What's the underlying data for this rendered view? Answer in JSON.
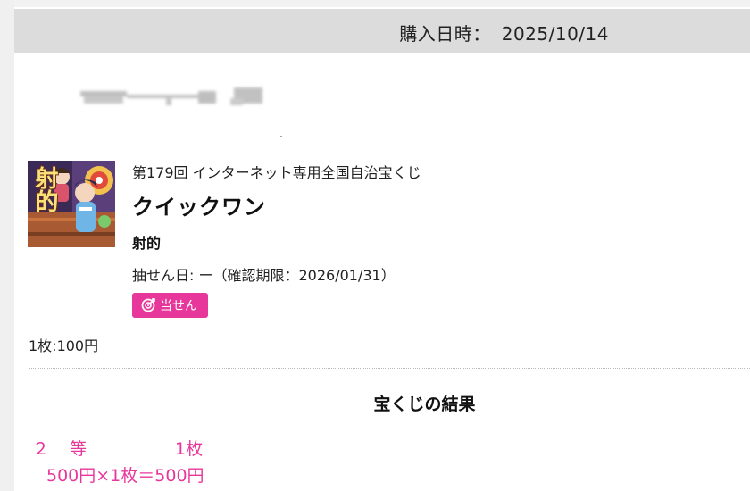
{
  "header": {
    "purchase_label": "購入日時：",
    "purchase_date": "2025/10/14"
  },
  "ticket": {
    "thumbnail_text": "射的",
    "round_title": "第179回 インターネット専用全国自治宝くじ",
    "product_name": "クイックワン",
    "subtype": "射的",
    "draw_info": "抽せん日: ー（確認期限：2026/01/31）",
    "status_badge": "当せん",
    "price": "1枚:100円"
  },
  "results": {
    "title": "宝くじの結果",
    "rows": [
      {
        "rank": "２　等",
        "count": "1枚",
        "calculation": "500円×1枚＝500円"
      }
    ]
  },
  "colors": {
    "accent": "#e8379b",
    "header_bg": "#dcdcdc"
  }
}
